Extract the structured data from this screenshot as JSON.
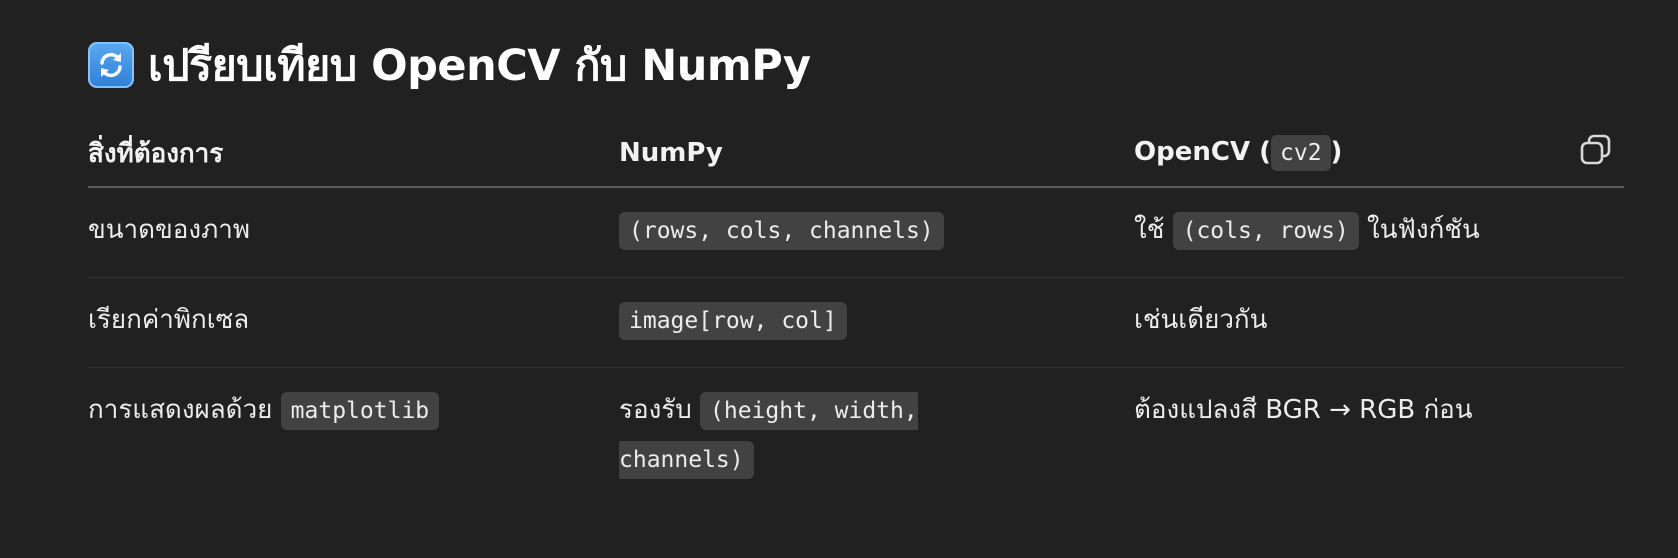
{
  "heading": {
    "icon": "repeat-arrows-emoji-icon",
    "text": "เปรียบเทียบ OpenCV กับ NumPy"
  },
  "table": {
    "headers": {
      "col1": "สิ่งที่ต้องการ",
      "col2": "NumPy",
      "col3_prefix": "OpenCV (",
      "col3_code": "cv2",
      "col3_suffix": ")"
    },
    "copy_icon": "copy-icon",
    "rows": [
      {
        "need": "ขนาดของภาพ",
        "numpy_code": "(rows, cols, channels)",
        "opencv_prefix": "ใช้ ",
        "opencv_code": "(cols, rows)",
        "opencv_suffix": " ในฟังก์ชัน"
      },
      {
        "need": "เรียกค่าพิกเซล",
        "numpy_code": "image[row, col]",
        "opencv_text": "เช่นเดียวกัน"
      },
      {
        "need_prefix": "การแสดงผลด้วย ",
        "need_code": "matplotlib",
        "numpy_prefix": "รองรับ ",
        "numpy_code": "(height, width, channels)",
        "opencv_text": "ต้องแปลงสี BGR → RGB ก่อน"
      }
    ]
  },
  "colors": {
    "background": "#212121",
    "text": "#ececec",
    "code_bg": "#424242",
    "header_rule": "#5a5a5a",
    "row_rule": "#343434"
  }
}
